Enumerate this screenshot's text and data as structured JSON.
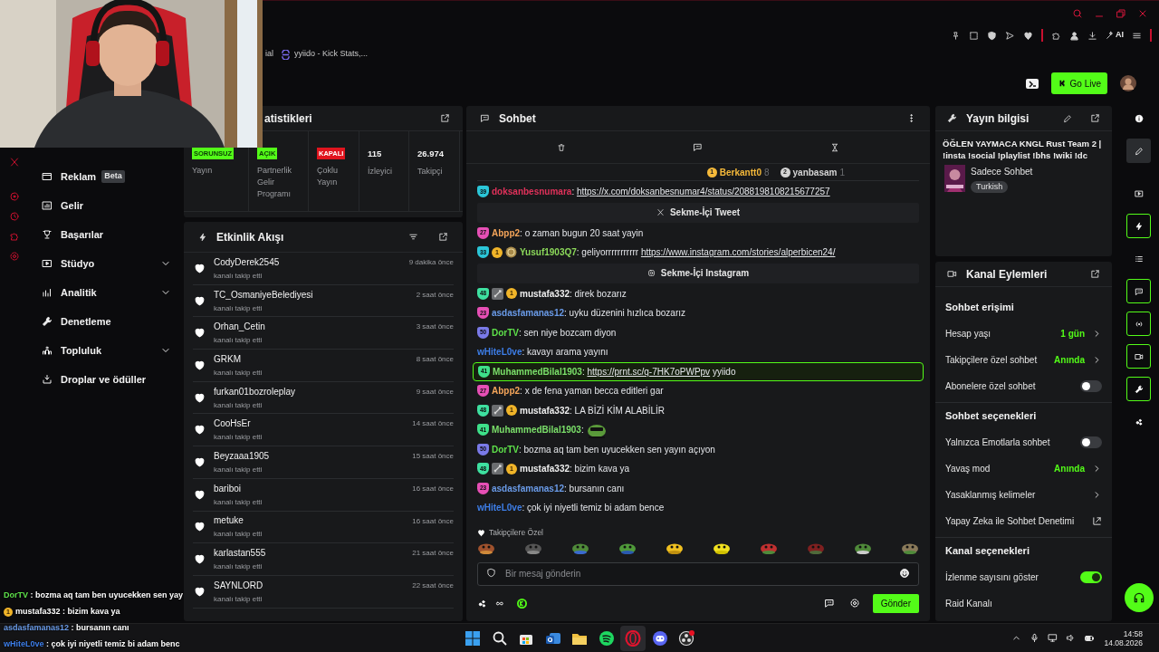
{
  "browser": {
    "bookmarks": [
      {
        "label": "ial",
        "has_icon": false
      },
      {
        "label": "yyiido - Kick Stats,...",
        "has_icon": true
      }
    ],
    "ai_label": "AI"
  },
  "header": {
    "go_live": "Go Live"
  },
  "sidebar": {
    "items": [
      {
        "label": "Reklam",
        "badge": "Beta",
        "expandable": false
      },
      {
        "label": "Gelir",
        "expandable": false
      },
      {
        "label": "Başarılar",
        "expandable": false
      },
      {
        "label": "Stüdyo",
        "expandable": true
      },
      {
        "label": "Analitik",
        "expandable": true
      },
      {
        "label": "Denetleme",
        "expandable": false
      },
      {
        "label": "Topluluk",
        "expandable": true
      },
      {
        "label": "Droplar ve ödüller",
        "expandable": false
      }
    ]
  },
  "stats": {
    "title": "atistikleri",
    "cells": [
      {
        "kind": "status",
        "label": "SORUNSUZ",
        "color": "#53fc18",
        "caption": "Yayın"
      },
      {
        "kind": "status",
        "label": "AÇIK",
        "color": "#53fc18",
        "caption": "Partnerlik Gelir Programı"
      },
      {
        "kind": "status",
        "label": "KAPALI",
        "color": "#e0141e",
        "caption": "Çoklu Yayın"
      },
      {
        "kind": "number",
        "value": "115",
        "caption": "İzleyici"
      },
      {
        "kind": "number",
        "value": "26.974",
        "caption": "Takipçi"
      }
    ]
  },
  "activity": {
    "title": "Etkinlik Akışı",
    "items": [
      {
        "name": "CodyDerek2545",
        "action": "kanalı takip etti",
        "time": "9 dakika önce"
      },
      {
        "name": "TC_OsmaniyeBelediyesi",
        "action": "kanalı takip etti",
        "time": "2 saat önce"
      },
      {
        "name": "Orhan_Cetin",
        "action": "kanalı takip etti",
        "time": "3 saat önce"
      },
      {
        "name": "GRKM",
        "action": "kanalı takip etti",
        "time": "8 saat önce"
      },
      {
        "name": "furkan01bozroleplay",
        "action": "kanalı takip etti",
        "time": "9 saat önce"
      },
      {
        "name": "CooHsEr",
        "action": "kanalı takip etti",
        "time": "14 saat önce"
      },
      {
        "name": "Beyzaaa1905",
        "action": "kanalı takip etti",
        "time": "15 saat önce"
      },
      {
        "name": "bariboi",
        "action": "kanalı takip etti",
        "time": "16 saat önce"
      },
      {
        "name": "metuke",
        "action": "kanalı takip etti",
        "time": "16 saat önce"
      },
      {
        "name": "karlastan555",
        "action": "kanalı takip etti",
        "time": "21 saat önce"
      },
      {
        "name": "SAYNLORD",
        "action": "kanalı takip etti",
        "time": "22 saat önce"
      }
    ]
  },
  "chat": {
    "title": "Sohbet",
    "leaders": [
      {
        "rank": "1",
        "name": "Berkantt0",
        "count": "8",
        "color": "#f5b93a"
      },
      {
        "rank": "2",
        "name": "yanbasam",
        "count": "1",
        "color": "#d4d4d4"
      }
    ],
    "messages": [
      {
        "kind": "message",
        "highlighted": false,
        "badges": [
          {
            "kind": "sub",
            "label": "39",
            "color": "#2bc6d8"
          }
        ],
        "name": "doksanbesnumara",
        "color": "#e0315a",
        "parts": [
          {
            "kind": "text",
            "text": ": "
          },
          {
            "kind": "link",
            "text": "https://x.com/doksanbesnumar4/status/2088198108215677257"
          }
        ]
      },
      {
        "kind": "tweet",
        "label": "Sekme-İçi Tweet"
      },
      {
        "kind": "message",
        "highlighted": false,
        "badges": [
          {
            "kind": "sub",
            "label": "27",
            "color": "#e64fb5"
          }
        ],
        "name": "Abpp2",
        "color": "#f5a55a",
        "parts": [
          {
            "kind": "text",
            "text": ": o zaman bugun 20 saat yayin"
          }
        ]
      },
      {
        "kind": "message",
        "highlighted": false,
        "badges": [
          {
            "kind": "sub",
            "label": "33",
            "color": "#2bc6d8"
          },
          {
            "kind": "rank",
            "label": "1"
          },
          {
            "kind": "medal"
          }
        ],
        "name": "Yusuf1903Q7",
        "color": "#8bd85a",
        "parts": [
          {
            "kind": "text",
            "text": ": geliyorrrrrrrrrrr "
          },
          {
            "kind": "link",
            "text": "https://www.instagram.com/stories/alperbicen24/"
          }
        ]
      },
      {
        "kind": "instagram",
        "label": "Sekme-İçi Instagram"
      },
      {
        "kind": "message",
        "highlighted": false,
        "badges": [
          {
            "kind": "sub",
            "label": "48",
            "color": "#3ee0a0"
          },
          {
            "kind": "gift"
          },
          {
            "kind": "rank",
            "label": "1"
          }
        ],
        "name": "mustafa332",
        "color": "#eeeeee",
        "parts": [
          {
            "kind": "text",
            "text": ": direk bozarız"
          }
        ]
      },
      {
        "kind": "message",
        "highlighted": false,
        "badges": [
          {
            "kind": "sub",
            "label": "23",
            "color": "#e64fb5"
          }
        ],
        "name": "asdasfamanas12",
        "color": "#6a9be8",
        "parts": [
          {
            "kind": "text",
            "text": ": uyku düzenini hızlıca bozarız"
          }
        ]
      },
      {
        "kind": "message",
        "highlighted": false,
        "badges": [
          {
            "kind": "sub",
            "label": "50",
            "color": "#7a7ae8"
          }
        ],
        "name": "DorTV",
        "color": "#5ee04a",
        "parts": [
          {
            "kind": "text",
            "text": ": sen niye bozcam diyon"
          }
        ]
      },
      {
        "kind": "message",
        "highlighted": false,
        "name": "wHiteL0ve",
        "color": "#3d7ee8",
        "parts": [
          {
            "kind": "text",
            "text": ": kavayı arama yayını"
          }
        ]
      },
      {
        "kind": "message",
        "highlighted": true,
        "badges": [
          {
            "kind": "sub",
            "label": "41",
            "color": "#3ee08a"
          }
        ],
        "name": "MuhammedBilal1903",
        "color": "#7be06a",
        "parts": [
          {
            "kind": "text",
            "text": ": "
          },
          {
            "kind": "link",
            "text": "https://prnt.sc/q-7HK7oPWPpv"
          },
          {
            "kind": "text",
            "text": " yyiido"
          }
        ]
      },
      {
        "kind": "message",
        "highlighted": false,
        "badges": [
          {
            "kind": "sub",
            "label": "27",
            "color": "#e64fb5"
          }
        ],
        "name": "Abpp2",
        "color": "#f5a55a",
        "parts": [
          {
            "kind": "text",
            "text": ": x de fena yaman becca editleri gar"
          }
        ]
      },
      {
        "kind": "message",
        "highlighted": false,
        "badges": [
          {
            "kind": "sub",
            "label": "48",
            "color": "#3ee0a0"
          },
          {
            "kind": "gift"
          },
          {
            "kind": "rank",
            "label": "1"
          }
        ],
        "name": "mustafa332",
        "color": "#eeeeee",
        "parts": [
          {
            "kind": "text",
            "text": ": LA BİZİ KİM ALABİLİR"
          }
        ]
      },
      {
        "kind": "message",
        "highlighted": false,
        "badges": [
          {
            "kind": "sub",
            "label": "41",
            "color": "#3ee08a"
          }
        ],
        "name": "MuhammedBilal1903",
        "color": "#7be06a",
        "parts": [
          {
            "kind": "text",
            "text": ":"
          },
          {
            "kind": "emote"
          }
        ]
      },
      {
        "kind": "message",
        "highlighted": false,
        "badges": [
          {
            "kind": "sub",
            "label": "50",
            "color": "#7a7ae8"
          }
        ],
        "name": "DorTV",
        "color": "#5ee04a",
        "parts": [
          {
            "kind": "text",
            "text": ": bozma aq tam ben uyucekken sen yayın açıyon"
          }
        ]
      },
      {
        "kind": "message",
        "highlighted": false,
        "badges": [
          {
            "kind": "sub",
            "label": "48",
            "color": "#3ee0a0"
          },
          {
            "kind": "gift"
          },
          {
            "kind": "rank",
            "label": "1"
          }
        ],
        "name": "mustafa332",
        "color": "#eeeeee",
        "parts": [
          {
            "kind": "text",
            "text": ": bizim kava ya"
          }
        ]
      },
      {
        "kind": "message",
        "highlighted": false,
        "badges": [
          {
            "kind": "sub",
            "label": "23",
            "color": "#e64fb5"
          }
        ],
        "name": "asdasfamanas12",
        "color": "#6a9be8",
        "parts": [
          {
            "kind": "text",
            "text": ": bursanın canı"
          }
        ]
      },
      {
        "kind": "message",
        "highlighted": false,
        "name": "wHiteL0ve",
        "color": "#3d7ee8",
        "parts": [
          {
            "kind": "text",
            "text": ": çok iyi niyetli temiz bi adam bence"
          }
        ]
      }
    ],
    "emote_section": "Takipçilere Özel",
    "input": {
      "placeholder": "Bir mesaj gönderin"
    },
    "send": "Gönder"
  },
  "stream_info": {
    "title": "Yayın bilgisi",
    "stream_title": "ÖĞLEN YAYMACA KNGL Rust Team 2 | !insta !social !playlist !bhs !wiki !dc",
    "category": "Sadece Sohbet",
    "tag": "Turkish"
  },
  "channel_actions": {
    "title": "Kanal Eylemleri",
    "rows": [
      {
        "kind": "heading",
        "label": "Sohbet erişimi"
      },
      {
        "kind": "value",
        "label": "Hesap yaşı",
        "value": "1 gün"
      },
      {
        "kind": "value",
        "label": "Takipçilere özel sohbet",
        "value": "Anında"
      },
      {
        "kind": "toggle",
        "label": "Abonelere özel sohbet",
        "on": false
      },
      {
        "kind": "heading",
        "label": "Sohbet seçenekleri"
      },
      {
        "kind": "toggle",
        "label": "Yalnızca Emotlarla sohbet",
        "on": false
      },
      {
        "kind": "value",
        "label": "Yavaş mod",
        "value": "Anında"
      },
      {
        "kind": "link",
        "label": "Yasaklanmış kelimeler"
      },
      {
        "kind": "external",
        "label": "Yapay Zeka ile Sohbet Denetimi"
      },
      {
        "kind": "heading",
        "label": "Kanal seçenekleri"
      },
      {
        "kind": "toggle",
        "label": "İzlenme sayısını göster",
        "on": true
      },
      {
        "kind": "plain",
        "label": "Raid Kanalı"
      }
    ]
  },
  "dock": [
    {
      "selected": false,
      "active": false
    },
    {
      "selected": true,
      "active": false
    },
    {
      "selected": false,
      "active": false
    },
    {
      "selected": false,
      "active": true
    },
    {
      "selected": false,
      "active": false
    },
    {
      "selected": false,
      "active": true
    },
    {
      "selected": false,
      "active": true
    },
    {
      "selected": false,
      "active": true
    },
    {
      "selected": false,
      "active": true
    },
    {
      "selected": false,
      "active": false
    }
  ],
  "overlay_chat": [
    {
      "name": "DorTV",
      "color": "#5ee04a",
      "text": " : bozma aq tam ben uyucekken sen yay"
    },
    {
      "name": "mustafa332",
      "color": "#ffffff",
      "badge": "1",
      "text": " : bizim kava ya"
    },
    {
      "name": "asdasfamanas12",
      "color": "#6a9be8",
      "text": " : bursanın canı"
    },
    {
      "name": "wHiteL0ve",
      "color": "#3d7ee8",
      "text": " : çok iyi niyetli temiz bi adam benc"
    }
  ],
  "taskbar": {
    "time": "14:58",
    "date": "14.08.2026"
  }
}
